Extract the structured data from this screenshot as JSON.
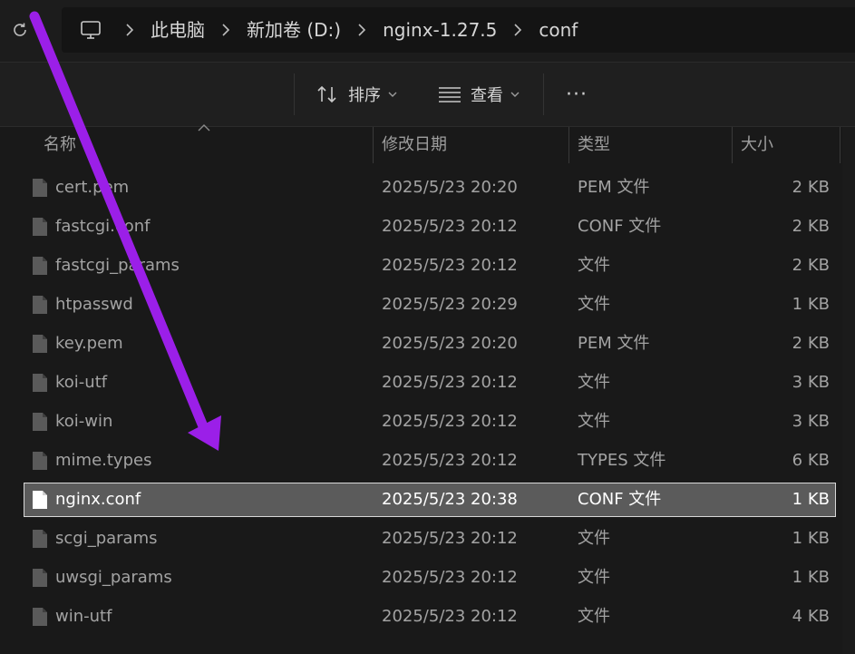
{
  "breadcrumb": {
    "items": [
      "此电脑",
      "新加卷 (D:)",
      "nginx-1.27.5",
      "conf"
    ]
  },
  "toolbar": {
    "sort_label": "排序",
    "view_label": "查看",
    "more_label": "···"
  },
  "columns": {
    "name": "名称",
    "date": "修改日期",
    "type": "类型",
    "size": "大小"
  },
  "files": [
    {
      "name": "cert.pem",
      "date": "2025/5/23 20:20",
      "type": "PEM 文件",
      "size": "2 KB",
      "selected": false
    },
    {
      "name": "fastcgi.conf",
      "date": "2025/5/23 20:12",
      "type": "CONF 文件",
      "size": "2 KB",
      "selected": false
    },
    {
      "name": "fastcgi_params",
      "date": "2025/5/23 20:12",
      "type": "文件",
      "size": "2 KB",
      "selected": false
    },
    {
      "name": "htpasswd",
      "date": "2025/5/23 20:29",
      "type": "文件",
      "size": "1 KB",
      "selected": false
    },
    {
      "name": "key.pem",
      "date": "2025/5/23 20:20",
      "type": "PEM 文件",
      "size": "2 KB",
      "selected": false
    },
    {
      "name": "koi-utf",
      "date": "2025/5/23 20:12",
      "type": "文件",
      "size": "3 KB",
      "selected": false
    },
    {
      "name": "koi-win",
      "date": "2025/5/23 20:12",
      "type": "文件",
      "size": "3 KB",
      "selected": false
    },
    {
      "name": "mime.types",
      "date": "2025/5/23 20:12",
      "type": "TYPES 文件",
      "size": "6 KB",
      "selected": false
    },
    {
      "name": "nginx.conf",
      "date": "2025/5/23 20:38",
      "type": "CONF 文件",
      "size": "1 KB",
      "selected": true
    },
    {
      "name": "scgi_params",
      "date": "2025/5/23 20:12",
      "type": "文件",
      "size": "1 KB",
      "selected": false
    },
    {
      "name": "uwsgi_params",
      "date": "2025/5/23 20:12",
      "type": "文件",
      "size": "1 KB",
      "selected": false
    },
    {
      "name": "win-utf",
      "date": "2025/5/23 20:12",
      "type": "文件",
      "size": "4 KB",
      "selected": false
    }
  ],
  "annotation": {
    "arrow_color": "#9b1fe8"
  }
}
